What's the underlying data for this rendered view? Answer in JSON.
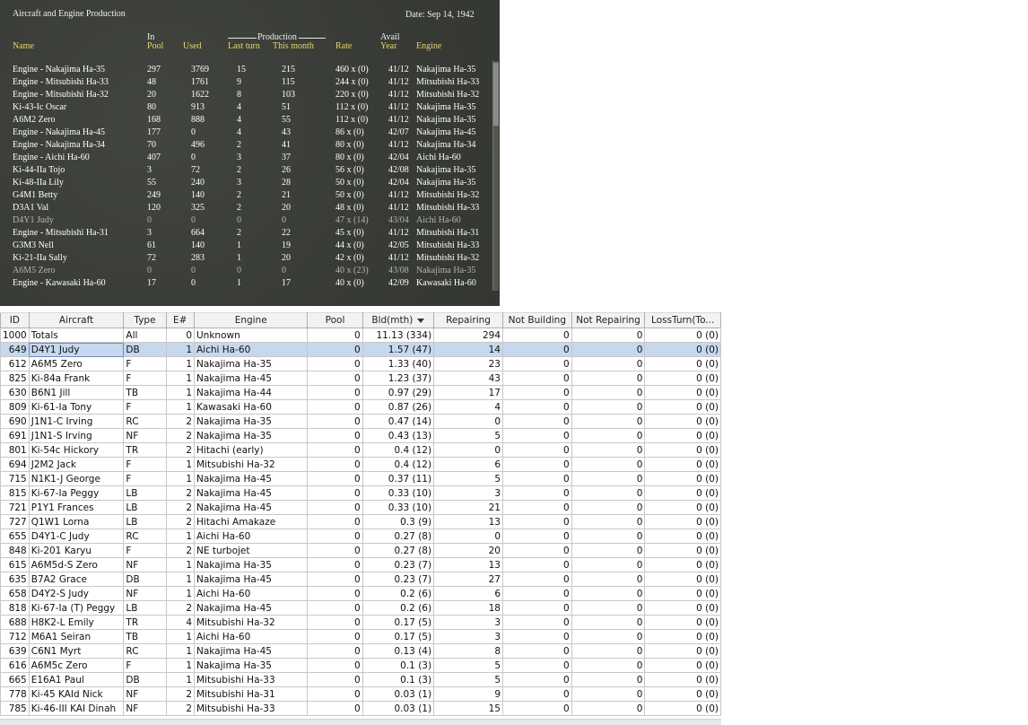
{
  "game": {
    "title": "Aircraft and Engine Production",
    "date": "Date: Sep 14, 1942",
    "headers": {
      "name": "Name",
      "in": "In",
      "pool": "Pool",
      "used": "Used",
      "production": "Production",
      "last_turn": "Last turn",
      "this_month": "This month",
      "rate": "Rate",
      "avail": "Avail",
      "year": "Year",
      "engine": "Engine"
    },
    "rows": [
      {
        "name": "Engine - Nakajima Ha-35",
        "pool": "297",
        "used": "3769",
        "last": "15",
        "month": "215",
        "rate": "460 x (0)",
        "year": "41/12",
        "engine": "Nakajima Ha-35",
        "dim": false
      },
      {
        "name": "Engine - Mitsubishi Ha-33",
        "pool": "48",
        "used": "1761",
        "last": "9",
        "month": "115",
        "rate": "244 x (0)",
        "year": "41/12",
        "engine": "Mitsubishi Ha-33",
        "dim": false
      },
      {
        "name": "Engine - Mitsubishi Ha-32",
        "pool": "20",
        "used": "1622",
        "last": "8",
        "month": "103",
        "rate": "220 x (0)",
        "year": "41/12",
        "engine": "Mitsubishi Ha-32",
        "dim": false
      },
      {
        "name": "Ki-43-Ic Oscar",
        "pool": "80",
        "used": "913",
        "last": "4",
        "month": "51",
        "rate": "112 x (0)",
        "year": "41/12",
        "engine": "Nakajima Ha-35",
        "dim": false
      },
      {
        "name": "A6M2 Zero",
        "pool": "168",
        "used": "888",
        "last": "4",
        "month": "55",
        "rate": "112 x (0)",
        "year": "41/12",
        "engine": "Nakajima Ha-35",
        "dim": false
      },
      {
        "name": "Engine - Nakajima Ha-45",
        "pool": "177",
        "used": "0",
        "last": "4",
        "month": "43",
        "rate": "86 x (0)",
        "year": "42/07",
        "engine": "Nakajima Ha-45",
        "dim": false
      },
      {
        "name": "Engine - Nakajima Ha-34",
        "pool": "70",
        "used": "496",
        "last": "2",
        "month": "41",
        "rate": "80 x (0)",
        "year": "41/12",
        "engine": "Nakajima Ha-34",
        "dim": false
      },
      {
        "name": "Engine - Aichi Ha-60",
        "pool": "407",
        "used": "0",
        "last": "3",
        "month": "37",
        "rate": "80 x (0)",
        "year": "42/04",
        "engine": "Aichi Ha-60",
        "dim": false
      },
      {
        "name": "Ki-44-IIa Tojo",
        "pool": "3",
        "used": "72",
        "last": "2",
        "month": "26",
        "rate": "56 x (0)",
        "year": "42/08",
        "engine": "Nakajima Ha-35",
        "dim": false
      },
      {
        "name": "Ki-48-IIa Lily",
        "pool": "55",
        "used": "240",
        "last": "3",
        "month": "28",
        "rate": "50 x (0)",
        "year": "42/04",
        "engine": "Nakajima Ha-35",
        "dim": false
      },
      {
        "name": "G4M1 Betty",
        "pool": "249",
        "used": "140",
        "last": "2",
        "month": "21",
        "rate": "50 x (0)",
        "year": "41/12",
        "engine": "Mitsubishi Ha-32",
        "dim": false
      },
      {
        "name": "D3A1 Val",
        "pool": "120",
        "used": "325",
        "last": "2",
        "month": "20",
        "rate": "48 x (0)",
        "year": "41/12",
        "engine": "Mitsubishi Ha-33",
        "dim": false
      },
      {
        "name": "D4Y1 Judy",
        "pool": "0",
        "used": "0",
        "last": "0",
        "month": "0",
        "rate": "47 x (14)",
        "year": "43/04",
        "engine": "Aichi Ha-60",
        "dim": true
      },
      {
        "name": "Engine - Mitsubishi Ha-31",
        "pool": "3",
        "used": "664",
        "last": "2",
        "month": "22",
        "rate": "45 x (0)",
        "year": "41/12",
        "engine": "Mitsubishi Ha-31",
        "dim": false
      },
      {
        "name": "G3M3 Nell",
        "pool": "61",
        "used": "140",
        "last": "1",
        "month": "19",
        "rate": "44 x (0)",
        "year": "42/05",
        "engine": "Mitsubishi Ha-33",
        "dim": false
      },
      {
        "name": "Ki-21-IIa Sally",
        "pool": "72",
        "used": "283",
        "last": "1",
        "month": "20",
        "rate": "42 x (0)",
        "year": "41/12",
        "engine": "Mitsubishi Ha-32",
        "dim": false
      },
      {
        "name": "A6M5 Zero",
        "pool": "0",
        "used": "0",
        "last": "0",
        "month": "0",
        "rate": "40 x (23)",
        "year": "43/08",
        "engine": "Nakajima Ha-35",
        "dim": true
      },
      {
        "name": "Engine - Kawasaki Ha-60",
        "pool": "17",
        "used": "0",
        "last": "1",
        "month": "17",
        "rate": "40 x (0)",
        "year": "42/09",
        "engine": "Kawasaki Ha-60",
        "dim": false
      }
    ]
  },
  "table": {
    "columns": [
      "ID",
      "Aircraft",
      "Type",
      "E#",
      "Engine",
      "Pool",
      "Bld(mth)",
      "Repairing",
      "Not Building",
      "Not Repairing",
      "LossTurn(To..."
    ],
    "sort_column": "Bld(mth)",
    "rows": [
      [
        "1000",
        "Totals",
        "All",
        "0",
        "Unknown",
        "0",
        "11.13 (334)",
        "294",
        "0",
        "0",
        "0 (0)"
      ],
      [
        "649",
        "D4Y1 Judy",
        "DB",
        "1",
        "Aichi Ha-60",
        "0",
        "1.57 (47)",
        "14",
        "0",
        "0",
        "0 (0)"
      ],
      [
        "612",
        "A6M5 Zero",
        "F",
        "1",
        "Nakajima Ha-35",
        "0",
        "1.33 (40)",
        "23",
        "0",
        "0",
        "0 (0)"
      ],
      [
        "825",
        "Ki-84a Frank",
        "F",
        "1",
        "Nakajima Ha-45",
        "0",
        "1.23 (37)",
        "43",
        "0",
        "0",
        "0 (0)"
      ],
      [
        "630",
        "B6N1 Jill",
        "TB",
        "1",
        "Nakajima Ha-44",
        "0",
        "0.97 (29)",
        "17",
        "0",
        "0",
        "0 (0)"
      ],
      [
        "809",
        "Ki-61-Ia Tony",
        "F",
        "1",
        "Kawasaki Ha-60",
        "0",
        "0.87 (26)",
        "4",
        "0",
        "0",
        "0 (0)"
      ],
      [
        "690",
        "J1N1-C Irving",
        "RC",
        "2",
        "Nakajima Ha-35",
        "0",
        "0.47 (14)",
        "0",
        "0",
        "0",
        "0 (0)"
      ],
      [
        "691",
        "J1N1-S Irving",
        "NF",
        "2",
        "Nakajima Ha-35",
        "0",
        "0.43 (13)",
        "5",
        "0",
        "0",
        "0 (0)"
      ],
      [
        "801",
        "Ki-54c Hickory",
        "TR",
        "2",
        "Hitachi (early)",
        "0",
        "0.4 (12)",
        "0",
        "0",
        "0",
        "0 (0)"
      ],
      [
        "694",
        "J2M2 Jack",
        "F",
        "1",
        "Mitsubishi Ha-32",
        "0",
        "0.4 (12)",
        "6",
        "0",
        "0",
        "0 (0)"
      ],
      [
        "715",
        "N1K1-J George",
        "F",
        "1",
        "Nakajima Ha-45",
        "0",
        "0.37 (11)",
        "5",
        "0",
        "0",
        "0 (0)"
      ],
      [
        "815",
        "Ki-67-Ia Peggy",
        "LB",
        "2",
        "Nakajima Ha-45",
        "0",
        "0.33 (10)",
        "3",
        "0",
        "0",
        "0 (0)"
      ],
      [
        "721",
        "P1Y1 Frances",
        "LB",
        "2",
        "Nakajima Ha-45",
        "0",
        "0.33 (10)",
        "21",
        "0",
        "0",
        "0 (0)"
      ],
      [
        "727",
        "Q1W1 Lorna",
        "LB",
        "2",
        "Hitachi Amakaze",
        "0",
        "0.3 (9)",
        "13",
        "0",
        "0",
        "0 (0)"
      ],
      [
        "655",
        "D4Y1-C Judy",
        "RC",
        "1",
        "Aichi Ha-60",
        "0",
        "0.27 (8)",
        "0",
        "0",
        "0",
        "0 (0)"
      ],
      [
        "848",
        "Ki-201 Karyu",
        "F",
        "2",
        "NE turbojet",
        "0",
        "0.27 (8)",
        "20",
        "0",
        "0",
        "0 (0)"
      ],
      [
        "615",
        "A6M5d-S Zero",
        "NF",
        "1",
        "Nakajima Ha-35",
        "0",
        "0.23 (7)",
        "13",
        "0",
        "0",
        "0 (0)"
      ],
      [
        "635",
        "B7A2 Grace",
        "DB",
        "1",
        "Nakajima Ha-45",
        "0",
        "0.23 (7)",
        "27",
        "0",
        "0",
        "0 (0)"
      ],
      [
        "658",
        "D4Y2-S Judy",
        "NF",
        "1",
        "Aichi Ha-60",
        "0",
        "0.2 (6)",
        "6",
        "0",
        "0",
        "0 (0)"
      ],
      [
        "818",
        "Ki-67-Ia (T) Peggy",
        "LB",
        "2",
        "Nakajima Ha-45",
        "0",
        "0.2 (6)",
        "18",
        "0",
        "0",
        "0 (0)"
      ],
      [
        "688",
        "H8K2-L Emily",
        "TR",
        "4",
        "Mitsubishi Ha-32",
        "0",
        "0.17 (5)",
        "3",
        "0",
        "0",
        "0 (0)"
      ],
      [
        "712",
        "M6A1 Seiran",
        "TB",
        "1",
        "Aichi Ha-60",
        "0",
        "0.17 (5)",
        "3",
        "0",
        "0",
        "0 (0)"
      ],
      [
        "639",
        "C6N1 Myrt",
        "RC",
        "1",
        "Nakajima Ha-45",
        "0",
        "0.13 (4)",
        "8",
        "0",
        "0",
        "0 (0)"
      ],
      [
        "616",
        "A6M5c Zero",
        "F",
        "1",
        "Nakajima Ha-35",
        "0",
        "0.1 (3)",
        "5",
        "0",
        "0",
        "0 (0)"
      ],
      [
        "665",
        "E16A1 Paul",
        "DB",
        "1",
        "Mitsubishi Ha-33",
        "0",
        "0.1 (3)",
        "5",
        "0",
        "0",
        "0 (0)"
      ],
      [
        "778",
        "Ki-45 KAId Nick",
        "NF",
        "2",
        "Mitsubishi Ha-31",
        "0",
        "0.03 (1)",
        "9",
        "0",
        "0",
        "0 (0)"
      ],
      [
        "785",
        "Ki-46-III KAI Dinah",
        "NF",
        "2",
        "Mitsubishi Ha-33",
        "0",
        "0.03 (1)",
        "15",
        "0",
        "0",
        "0 (0)"
      ]
    ]
  }
}
